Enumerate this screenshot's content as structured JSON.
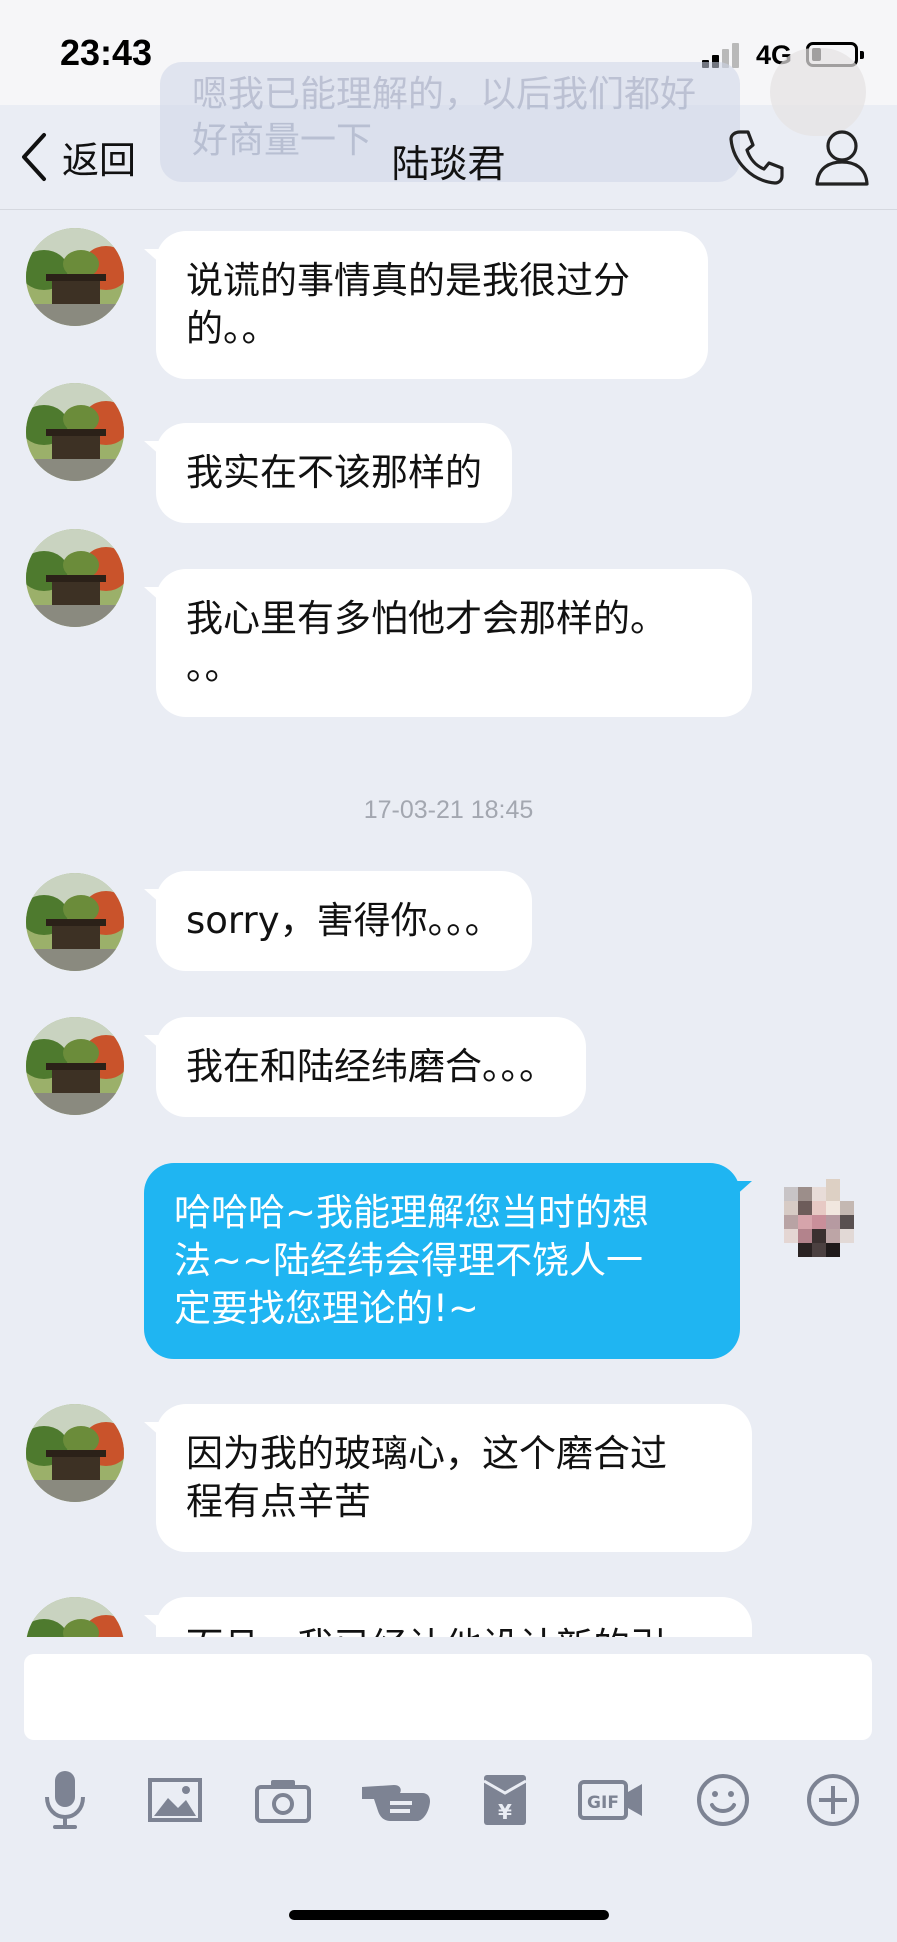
{
  "status_bar": {
    "time": "23:43",
    "network": "4G",
    "battery_level": 0.2
  },
  "banner": {
    "text": "嗯我已能理解的，以后我们都好好商量一下"
  },
  "nav": {
    "back_label": "返回",
    "title": "陆琰君",
    "icons": [
      "phone-icon",
      "profile-icon"
    ]
  },
  "messages": [
    {
      "sender": "other",
      "text": "说谎的事情真的是我很过分\n的。。"
    },
    {
      "sender": "other",
      "text": "我实在不该那样的"
    },
    {
      "sender": "other",
      "text": "我心里有多怕他才会那样的。\n。。"
    },
    {
      "sender": "time",
      "text": "17-03-21 18:45"
    },
    {
      "sender": "other",
      "text": "sorry，害得你。。。"
    },
    {
      "sender": "other",
      "text": "我在和陆经纬磨合。。。"
    },
    {
      "sender": "self",
      "text": "哈哈哈~我能理解您当时的想\n法~~陆经纬会得理不饶人一\n定要找您理论的!~"
    },
    {
      "sender": "other",
      "text": "因为我的玻璃心，这个磨合过\n程有点辛苦"
    },
    {
      "sender": "other",
      "text": "而且，我已经让他设计新的引"
    }
  ],
  "input": {
    "value": ""
  },
  "toolbar": {
    "icons": [
      "microphone-icon",
      "image-icon",
      "camera-icon",
      "hand-icon",
      "red-packet-icon",
      "gif-icon",
      "emoji-icon",
      "plus-icon"
    ]
  },
  "colors": {
    "background": "#eaedf4",
    "self_bubble": "#1fb5f2",
    "other_bubble": "#ffffff",
    "toolbar_icon": "#7d8393"
  }
}
